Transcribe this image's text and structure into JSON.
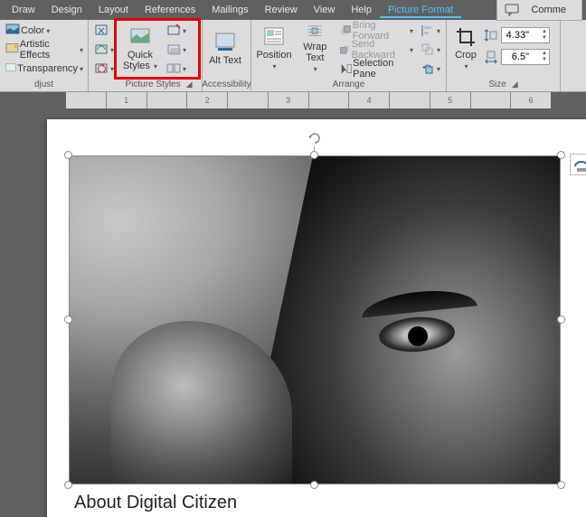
{
  "menu": {
    "items": [
      "Draw",
      "Design",
      "Layout",
      "References",
      "Mailings",
      "Review",
      "View",
      "Help",
      "Picture Format"
    ],
    "active": 8,
    "comment": "Comme"
  },
  "adjust": {
    "color": "Color",
    "artistic": "Artistic Effects",
    "transparency": "Transparency",
    "label": "djust"
  },
  "styles": {
    "quick": "Quick Styles",
    "label": "Picture Styles"
  },
  "acc": {
    "alt": "Alt Text",
    "label": "Accessibility"
  },
  "arrange": {
    "position": "Position",
    "wrap": "Wrap Text",
    "bring": "Bring Forward",
    "send": "Send Backward",
    "pane": "Selection Pane",
    "label": "Arrange"
  },
  "size": {
    "crop": "Crop",
    "h": "4.33\"",
    "w": "6.5\"",
    "label": "Size"
  },
  "ruler": [
    "",
    "1",
    "",
    "2",
    "",
    "3",
    "",
    "4",
    "",
    "5",
    "",
    "6"
  ],
  "doc": {
    "caption": "About Digital Citizen"
  }
}
